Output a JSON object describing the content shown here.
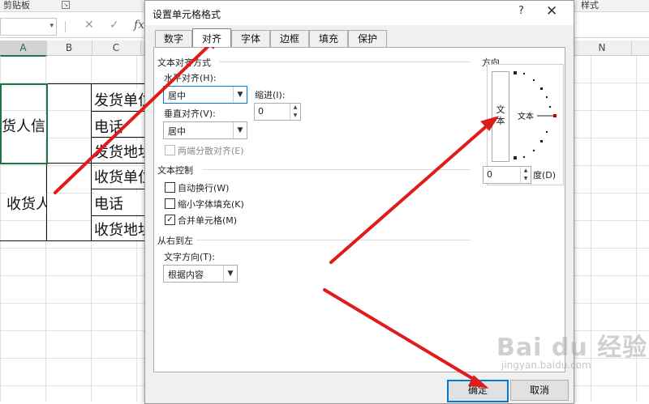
{
  "excel": {
    "ribbon_group_clipboard": "剪贴板",
    "ribbon_group_styles": "样式",
    "formula_cancel": "✕",
    "formula_confirm": "✓",
    "formula_fx": "fx",
    "columns": [
      "A",
      "B",
      "C",
      "N"
    ],
    "cells": {
      "a_merged": "货人信",
      "a_merged2": "收货人",
      "c1": "发货单位",
      "c2": "电话",
      "c3": "发货地址",
      "c4": "收货单位",
      "c5": "电话",
      "c6": "收货地址"
    }
  },
  "dialog": {
    "title": "设置单元格格式",
    "help": "?",
    "close": "✕",
    "tabs": [
      {
        "label": "数字",
        "active": false
      },
      {
        "label": "对齐",
        "active": true
      },
      {
        "label": "字体",
        "active": false
      },
      {
        "label": "边框",
        "active": false
      },
      {
        "label": "填充",
        "active": false
      },
      {
        "label": "保护",
        "active": false
      }
    ],
    "text_alignment": {
      "section": "文本对齐方式",
      "horizontal_label": "水平对齐(H):",
      "horizontal_value": "居中",
      "indent_label": "缩进(I):",
      "indent_value": "0",
      "vertical_label": "垂直对齐(V):",
      "vertical_value": "居中",
      "justify_distributed": "两端分散对齐(E)"
    },
    "text_control": {
      "section": "文本控制",
      "wrap_text": {
        "label": "自动换行(W)",
        "checked": false
      },
      "shrink_to_fit": {
        "label": "缩小字体填充(K)",
        "checked": false
      },
      "merge_cells": {
        "label": "合并单元格(M)",
        "checked": true
      }
    },
    "rtl": {
      "section": "从右到左",
      "direction_label": "文字方向(T):",
      "direction_value": "根据内容"
    },
    "orientation": {
      "section": "方向",
      "vertical_text": "文本",
      "dial_text": "文本",
      "degrees_value": "0",
      "degrees_label": "度(D)"
    },
    "ok": "确定",
    "cancel": "取消"
  },
  "watermark": {
    "text": "Bai du 经验",
    "sub": "jingyan.baidu.com"
  },
  "colors": {
    "excel_green": "#217346",
    "focus_blue": "#0078d7",
    "arrow_red": "#e01b1b",
    "dial_red": "#c00000"
  }
}
